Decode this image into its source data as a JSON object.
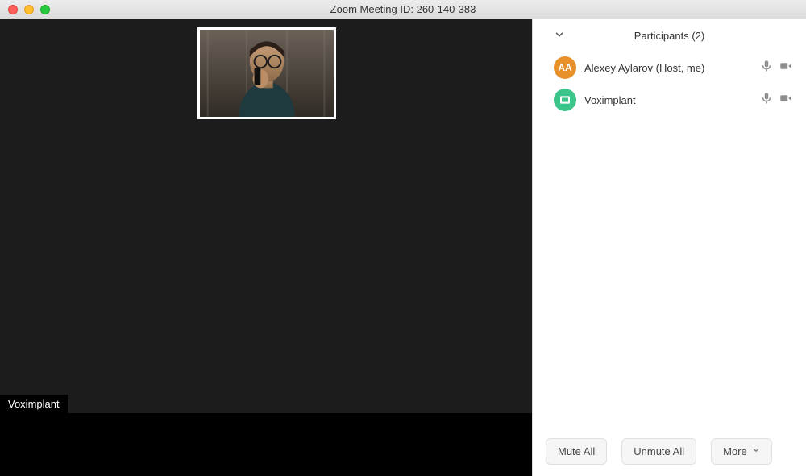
{
  "title": "Zoom Meeting ID: 260-140-383",
  "video": {
    "active_speaker_label": "Voximplant"
  },
  "participants": {
    "title": "Participants (2)",
    "items": [
      {
        "name": "Alexey Aylarov (Host, me)",
        "avatar": {
          "type": "initials",
          "text": "AA",
          "color": "#e8912a"
        }
      },
      {
        "name": "Voximplant",
        "avatar": {
          "type": "logo",
          "color": "#3cc58b"
        }
      }
    ]
  },
  "footer": {
    "mute_all": "Mute All",
    "unmute_all": "Unmute All",
    "more": "More"
  }
}
